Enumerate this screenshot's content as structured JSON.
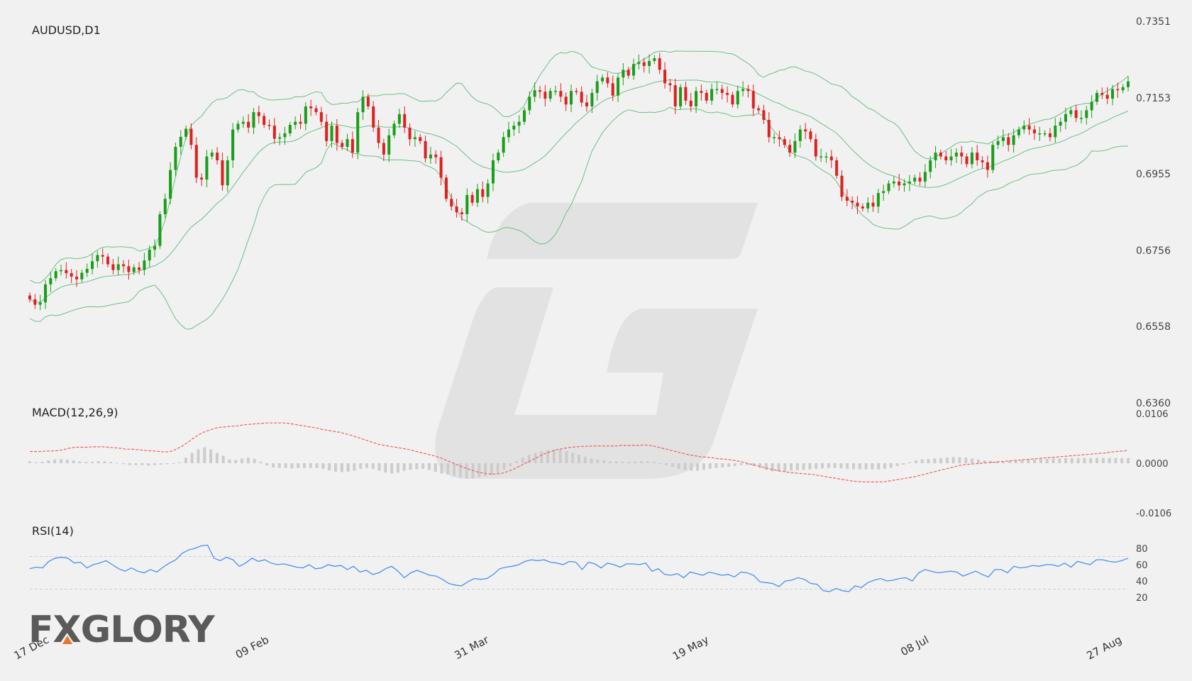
{
  "chart_data": [
    {
      "type": "candlestick",
      "title": "AUDUSD,D1",
      "ylim": [
        0.636,
        0.7351
      ],
      "y_ticks": [
        "0.7351",
        "0.7153",
        "0.6955",
        "0.6756",
        "0.6558",
        "0.6360"
      ],
      "x_ticks": [
        "17 Dec",
        "09 Feb",
        "31 Mar",
        "19 May",
        "08 Jul",
        "27 Aug"
      ],
      "up_color": "#1a9e1a",
      "down_color": "#e02020",
      "band_color": "#6cbf86",
      "close": [
        0.6629,
        0.6615,
        0.6621,
        0.6668,
        0.6684,
        0.6702,
        0.6705,
        0.6697,
        0.6688,
        0.6681,
        0.6698,
        0.6708,
        0.6728,
        0.6744,
        0.674,
        0.672,
        0.6705,
        0.672,
        0.6715,
        0.67,
        0.6712,
        0.6705,
        0.673,
        0.6758,
        0.6768,
        0.685,
        0.689,
        0.6965,
        0.7025,
        0.7051,
        0.7072,
        0.703,
        0.6945,
        0.694,
        0.7,
        0.701,
        0.699,
        0.6925,
        0.699,
        0.707,
        0.7085,
        0.709,
        0.7075,
        0.7115,
        0.7105,
        0.7082,
        0.708,
        0.7046,
        0.705,
        0.706,
        0.7082,
        0.709,
        0.7085,
        0.713,
        0.7125,
        0.7115,
        0.709,
        0.704,
        0.708,
        0.7035,
        0.7025,
        0.7045,
        0.701,
        0.7115,
        0.7155,
        0.713,
        0.7075,
        0.7035,
        0.7005,
        0.7055,
        0.7085,
        0.711,
        0.7075,
        0.7045,
        0.705,
        0.704,
        0.6995,
        0.7005,
        0.6998,
        0.6945,
        0.689,
        0.687,
        0.6855,
        0.685,
        0.69,
        0.688,
        0.6915,
        0.6895,
        0.693,
        0.699,
        0.701,
        0.705,
        0.707,
        0.708,
        0.709,
        0.712,
        0.7155,
        0.7172,
        0.7168,
        0.715,
        0.717,
        0.717,
        0.7155,
        0.7135,
        0.717,
        0.7168,
        0.714,
        0.713,
        0.7165,
        0.7195,
        0.7205,
        0.719,
        0.7158,
        0.7205,
        0.7225,
        0.721,
        0.724,
        0.7245,
        0.7235,
        0.7248,
        0.7255,
        0.7225,
        0.719,
        0.7185,
        0.713,
        0.718,
        0.7145,
        0.713,
        0.717,
        0.7165,
        0.7145,
        0.7175,
        0.7175,
        0.7165,
        0.716,
        0.7135,
        0.717,
        0.7175,
        0.717,
        0.7125,
        0.712,
        0.7095,
        0.705,
        0.705,
        0.7045,
        0.703,
        0.701,
        0.704,
        0.707,
        0.7065,
        0.7045,
        0.7,
        0.7,
        0.7,
        0.699,
        0.695,
        0.6895,
        0.6885,
        0.688,
        0.687,
        0.6865,
        0.688,
        0.687,
        0.6905,
        0.691,
        0.693,
        0.6935,
        0.6925,
        0.693,
        0.6935,
        0.6945,
        0.6935,
        0.696,
        0.699,
        0.701,
        0.7,
        0.699,
        0.7,
        0.701,
        0.7,
        0.698,
        0.701,
        0.699,
        0.6985,
        0.6965,
        0.703,
        0.704,
        0.705,
        0.703,
        0.7055,
        0.707,
        0.708,
        0.707,
        0.706,
        0.706,
        0.706,
        0.705,
        0.708,
        0.709,
        0.711,
        0.712,
        0.71,
        0.71,
        0.712,
        0.7142,
        0.7165,
        0.716,
        0.715,
        0.7175,
        0.7172,
        0.718,
        0.7195
      ]
    },
    {
      "type": "line",
      "title": "MACD(12,26,9)",
      "ylim": [
        -0.0106,
        0.0106
      ],
      "y_ticks": [
        "0.0106",
        "0.0000",
        "-0.0106"
      ],
      "signal_color": "#f06060",
      "hist_color": "#cccccc",
      "signal": [
        0.0025,
        0.0025,
        0.0025,
        0.0026,
        0.0026,
        0.0027,
        0.0029,
        0.0032,
        0.0034,
        0.0034,
        0.0034,
        0.0035,
        0.0035,
        0.0035,
        0.0034,
        0.0033,
        0.0032,
        0.003,
        0.003,
        0.0029,
        0.0028,
        0.0027,
        0.0026,
        0.0025,
        0.0024,
        0.0025,
        0.003,
        0.0036,
        0.0044,
        0.0053,
        0.0061,
        0.0067,
        0.0071,
        0.0075,
        0.0077,
        0.0078,
        0.0079,
        0.008,
        0.0082,
        0.0083,
        0.0084,
        0.0085,
        0.0086,
        0.0086,
        0.0086,
        0.0086,
        0.0085,
        0.0083,
        0.0081,
        0.0079,
        0.0077,
        0.0075,
        0.0072,
        0.007,
        0.0068,
        0.0066,
        0.0063,
        0.006,
        0.0056,
        0.0052,
        0.0048,
        0.0044,
        0.004,
        0.0038,
        0.0036,
        0.0034,
        0.0032,
        0.003,
        0.0027,
        0.0024,
        0.0021,
        0.0018,
        0.0015,
        0.0011,
        0.0006,
        0.0001,
        -0.0004,
        -0.0009,
        -0.0013,
        -0.0017,
        -0.002,
        -0.0022,
        -0.0023,
        -0.0023,
        -0.0021,
        -0.0017,
        -0.0012,
        -0.0006,
        0.0,
        0.0006,
        0.0012,
        0.0018,
        0.0023,
        0.0027,
        0.003,
        0.0032,
        0.0034,
        0.0035,
        0.0036,
        0.0036,
        0.0037,
        0.0037,
        0.0037,
        0.0037,
        0.0037,
        0.0038,
        0.0038,
        0.0038,
        0.0038,
        0.0039,
        0.0038,
        0.0036,
        0.0033,
        0.003,
        0.0027,
        0.0024,
        0.0021,
        0.0018,
        0.0016,
        0.0014,
        0.0013,
        0.0012,
        0.001,
        0.0009,
        0.0008,
        0.0006,
        0.0004,
        0.0001,
        -0.0002,
        -0.0005,
        -0.0008,
        -0.0011,
        -0.0014,
        -0.0016,
        -0.0018,
        -0.002,
        -0.0021,
        -0.0022,
        -0.0023,
        -0.0024,
        -0.0026,
        -0.0028,
        -0.003,
        -0.0032,
        -0.0034,
        -0.0036,
        -0.0038,
        -0.0039,
        -0.004,
        -0.004,
        -0.004,
        -0.004,
        -0.0039,
        -0.0037,
        -0.0035,
        -0.0033,
        -0.0031,
        -0.0029,
        -0.0026,
        -0.0023,
        -0.002,
        -0.0017,
        -0.0014,
        -0.0011,
        -0.0008,
        -0.0005,
        -0.0003,
        -0.0002,
        -0.0001,
        0.0,
        0.0001,
        0.0002,
        0.0003,
        0.0004,
        0.0005,
        0.0006,
        0.0007,
        0.0008,
        0.0009,
        0.001,
        0.0011,
        0.0012,
        0.0013,
        0.0014,
        0.0015,
        0.0016,
        0.0017,
        0.0018,
        0.0019,
        0.002,
        0.0021,
        0.0022,
        0.0024,
        0.0025,
        0.0026,
        0.0027
      ],
      "histogram": [
        0.0004,
        0.0002,
        0.0003,
        0.0006,
        0.0008,
        0.0009,
        0.0008,
        0.0006,
        0.0004,
        0.0003,
        0.0003,
        0.0004,
        0.0004,
        0.0003,
        0.0001,
        -0.0002,
        -0.0004,
        -0.0004,
        -0.0004,
        -0.0005,
        -0.0004,
        -0.0003,
        -0.0002,
        -0.0001,
        0.0002,
        0.0012,
        0.0022,
        0.003,
        0.0034,
        0.003,
        0.0022,
        0.0016,
        0.0008,
        0.0007,
        0.001,
        0.0012,
        0.0009,
        0.0003,
        -0.0005,
        -0.0009,
        -0.001,
        -0.001,
        -0.0011,
        -0.001,
        -0.001,
        -0.001,
        -0.001,
        -0.0012,
        -0.0015,
        -0.0018,
        -0.0019,
        -0.0018,
        -0.0016,
        -0.0012,
        -0.001,
        -0.0012,
        -0.0016,
        -0.002,
        -0.0022,
        -0.002,
        -0.0016,
        -0.0014,
        -0.0013,
        -0.0012,
        -0.0014,
        -0.0018,
        -0.0022,
        -0.0024,
        -0.0027,
        -0.003,
        -0.0033,
        -0.0032,
        -0.003,
        -0.0028,
        -0.0026,
        -0.0022,
        -0.0014,
        -0.0006,
        0.0004,
        0.0012,
        0.0018,
        0.0022,
        0.0025,
        0.0028,
        0.0029,
        0.003,
        0.0026,
        0.0022,
        0.0018,
        0.0014,
        0.001,
        0.0008,
        0.0006,
        0.0004,
        0.0004,
        0.0003,
        0.0003,
        0.0004,
        0.0004,
        0.0004,
        0.0003,
        0.0,
        -0.0004,
        -0.0008,
        -0.0012,
        -0.0015,
        -0.0016,
        -0.0016,
        -0.0014,
        -0.0012,
        -0.001,
        -0.0009,
        -0.0008,
        -0.0006,
        -0.0004,
        -0.0004,
        -0.0006,
        -0.001,
        -0.0014,
        -0.0017,
        -0.0018,
        -0.0018,
        -0.0016,
        -0.0015,
        -0.0014,
        -0.0013,
        -0.0012,
        -0.0011,
        -0.001,
        -0.001,
        -0.0011,
        -0.0012,
        -0.0013,
        -0.0013,
        -0.0013,
        -0.0013,
        -0.0013,
        -0.0012,
        -0.001,
        -0.0006,
        -0.0003,
        0.0002,
        0.0006,
        0.0008,
        0.0009,
        0.001,
        0.0011,
        0.0012,
        0.0013,
        0.0013,
        0.0012,
        0.001,
        0.0008,
        0.0006,
        0.0005,
        0.0004,
        0.0004,
        0.0005,
        0.0006,
        0.0007,
        0.0008,
        0.0008,
        0.0009,
        0.0009,
        0.001,
        0.001,
        0.0011,
        0.0011,
        0.0011,
        0.0011,
        0.0011,
        0.0011,
        0.0011,
        0.0011,
        0.0011,
        0.0011,
        0.0011
      ]
    },
    {
      "type": "line",
      "title": "RSI(14)",
      "ylim": [
        10,
        90
      ],
      "y_ticks": [
        "80",
        "60",
        "40",
        "20"
      ],
      "levels": [
        70,
        30
      ],
      "line_color": "#4a8ff0",
      "values": [
        55,
        57,
        56,
        64,
        68,
        69,
        68,
        62,
        63,
        56,
        60,
        62,
        65,
        60,
        55,
        52,
        56,
        52,
        50,
        54,
        51,
        57,
        62,
        66,
        74,
        78,
        80,
        83,
        84,
        68,
        65,
        69,
        66,
        58,
        62,
        68,
        64,
        66,
        62,
        60,
        61,
        59,
        57,
        56,
        60,
        55,
        56,
        60,
        58,
        59,
        54,
        58,
        51,
        53,
        48,
        50,
        55,
        58,
        52,
        44,
        50,
        53,
        50,
        47,
        46,
        42,
        37,
        35,
        34,
        39,
        43,
        42,
        43,
        48,
        55,
        57,
        58,
        60,
        64,
        66,
        65,
        66,
        63,
        62,
        60,
        64,
        63,
        54,
        63,
        61,
        56,
        62,
        60,
        57,
        61,
        61,
        60,
        62,
        52,
        55,
        48,
        47,
        49,
        44,
        51,
        49,
        47,
        51,
        49,
        47,
        48,
        45,
        51,
        50,
        47,
        39,
        38,
        37,
        33,
        40,
        41,
        44,
        42,
        37,
        36,
        28,
        27,
        31,
        28,
        27,
        34,
        32,
        38,
        41,
        43,
        40,
        41,
        43,
        44,
        40,
        50,
        54,
        52,
        50,
        51,
        52,
        51,
        46,
        49,
        52,
        48,
        45,
        54,
        54,
        50,
        58,
        56,
        57,
        59,
        58,
        60,
        60,
        58,
        62,
        57,
        64,
        62,
        60,
        66,
        66,
        64,
        63,
        65,
        68
      ]
    }
  ]
}
